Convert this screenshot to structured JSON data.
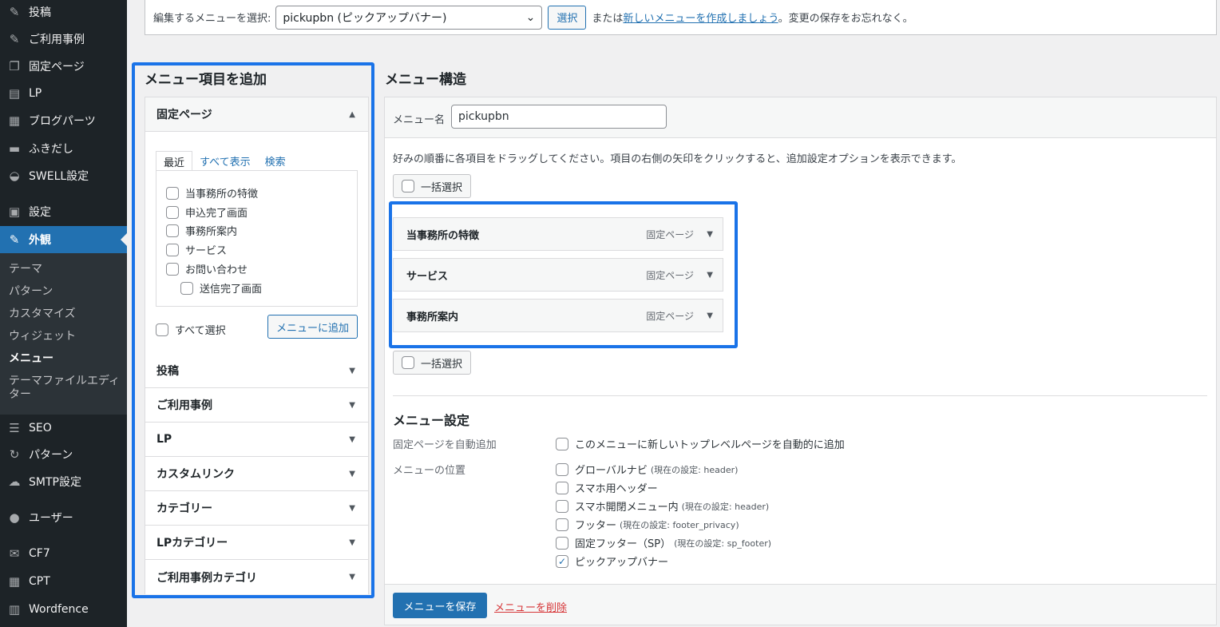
{
  "sidebar": {
    "items": [
      {
        "label": "投稿",
        "icon": "pin-icon",
        "glyph": "✎"
      },
      {
        "label": "ご利用事例",
        "icon": "pin-icon",
        "glyph": "✎"
      },
      {
        "label": "固定ページ",
        "icon": "pages-icon",
        "glyph": "❐"
      },
      {
        "label": "LP",
        "icon": "document-icon",
        "glyph": "▤"
      },
      {
        "label": "ブログパーツ",
        "icon": "grid-icon",
        "glyph": "▦"
      },
      {
        "label": "ふきだし",
        "icon": "speech-bubble-icon",
        "glyph": "▬"
      },
      {
        "label": "SWELL設定",
        "icon": "swell-icon",
        "glyph": "◒"
      },
      {
        "label": "設定",
        "icon": "settings-icon",
        "glyph": "▣"
      },
      {
        "label": "外観",
        "icon": "appearance-icon",
        "glyph": "✎"
      }
    ],
    "submenu": [
      {
        "label": "テーマ"
      },
      {
        "label": "パターン"
      },
      {
        "label": "カスタマイズ"
      },
      {
        "label": "ウィジェット"
      },
      {
        "label": "メニュー"
      },
      {
        "label": "テーマファイルエディター"
      }
    ],
    "items2": [
      {
        "label": "SEO",
        "icon": "seo-icon",
        "glyph": "☰"
      },
      {
        "label": "パターン",
        "icon": "refresh-icon",
        "glyph": "↻"
      },
      {
        "label": "SMTP設定",
        "icon": "cloud-icon",
        "glyph": "☁"
      },
      {
        "label": "ユーザー",
        "icon": "user-icon",
        "glyph": "●"
      },
      {
        "label": "CF7",
        "icon": "mail-icon",
        "glyph": "✉"
      },
      {
        "label": "CPT",
        "icon": "cpt-icon",
        "glyph": "▦"
      },
      {
        "label": "Wordfence",
        "icon": "wordfence-icon",
        "glyph": "▥"
      }
    ]
  },
  "topbar": {
    "select_label": "編集するメニューを選択:",
    "selected_menu": "pickupbn (ピックアップバナー)",
    "select_button": "選択",
    "or_text": "または",
    "create_link": "新しいメニューを作成しましょう",
    "save_reminder": "。変更の保存をお忘れなく。"
  },
  "add_items": {
    "title": "メニュー項目を追加",
    "pages_section": "固定ページ",
    "tabs": [
      "最近",
      "すべて表示",
      "検索"
    ],
    "pages": [
      "当事務所の特徴",
      "申込完了画面",
      "事務所案内",
      "サービス",
      "お問い合わせ",
      "送信完了画面"
    ],
    "select_all": "すべて選択",
    "add_button": "メニューに追加",
    "sections": [
      "投稿",
      "ご利用事例",
      "LP",
      "カスタムリンク",
      "カテゴリー",
      "LPカテゴリー",
      "ご利用事例カテゴリ"
    ]
  },
  "structure": {
    "title": "メニュー構造",
    "name_label": "メニュー名",
    "name_value": "pickupbn",
    "instructions": "好みの順番に各項目をドラッグしてください。項目の右側の矢印をクリックすると、追加設定オプションを表示できます。",
    "bulk_select": "一括選択",
    "items": [
      {
        "title": "当事務所の特徴",
        "type": "固定ページ"
      },
      {
        "title": "サービス",
        "type": "固定ページ"
      },
      {
        "title": "事務所案内",
        "type": "固定ページ"
      }
    ]
  },
  "settings": {
    "title": "メニュー設定",
    "auto_add_label": "固定ページを自動追加",
    "auto_add_option": "このメニューに新しいトップレベルページを自動的に追加",
    "location_label": "メニューの位置",
    "locations": [
      {
        "label": "グローバルナビ",
        "note": "(現在の設定: header)",
        "checked": false
      },
      {
        "label": "スマホ用ヘッダー",
        "note": "",
        "checked": false
      },
      {
        "label": "スマホ開閉メニュー内",
        "note": "(現在の設定: header)",
        "checked": false
      },
      {
        "label": "フッター",
        "note": "(現在の設定: footer_privacy)",
        "checked": false
      },
      {
        "label": "固定フッター（SP）",
        "note": "(現在の設定: sp_footer)",
        "checked": false
      },
      {
        "label": "ピックアップバナー",
        "note": "",
        "checked": true
      }
    ]
  },
  "footer": {
    "save_button": "メニューを保存",
    "delete_link": "メニューを削除"
  },
  "colors": {
    "highlight": "#1a73e8",
    "primary": "#2271b1",
    "sidebar_bg": "#1d2327"
  }
}
